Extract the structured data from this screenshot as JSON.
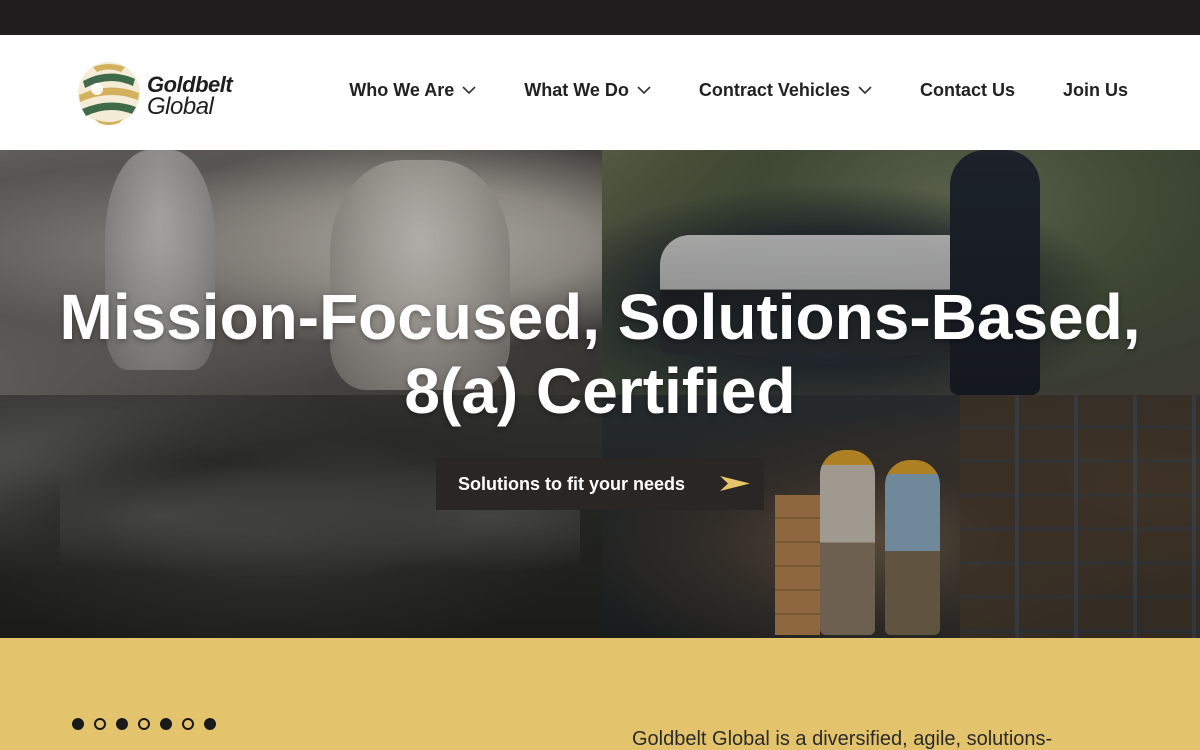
{
  "header": {
    "logo": {
      "line1": "Goldbelt",
      "line2": "Global"
    },
    "nav": [
      {
        "label": "Who We Are",
        "has_dropdown": true
      },
      {
        "label": "What We Do",
        "has_dropdown": true
      },
      {
        "label": "Contract Vehicles",
        "has_dropdown": true
      },
      {
        "label": "Contact Us",
        "has_dropdown": false
      },
      {
        "label": "Join Us",
        "has_dropdown": false
      }
    ]
  },
  "hero": {
    "title_line1": "Mission-Focused, Solutions-Based,",
    "title_line2": "8(a) Certified",
    "cta_label": "Solutions to fit your needs",
    "cta_icon": "arrow-right-icon"
  },
  "band": {
    "carousel_dots": [
      true,
      false,
      true,
      false,
      true,
      false,
      true
    ],
    "intro_text": "Goldbelt Global is a diversified, agile, solutions-"
  },
  "colors": {
    "topbar": "#1f1d1e",
    "accent_gold": "#e3c46d",
    "cta_background": "#2a2624",
    "cta_arrow": "#e8c56a",
    "logo_green": "#3f6b4a"
  }
}
